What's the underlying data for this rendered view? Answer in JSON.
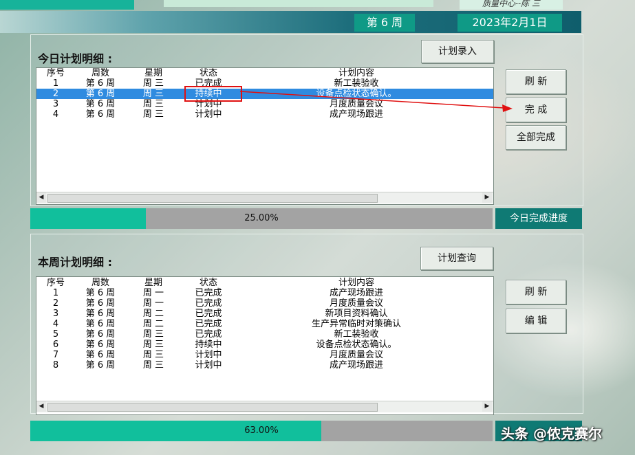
{
  "header": {
    "top_right_tab": "质量中心--陈 三",
    "week_label": "第 6 周",
    "date_label": "2023年2月1日"
  },
  "today": {
    "title": "今日计划明细 :",
    "entry_button": "计划录入",
    "columns": [
      "序号",
      "周数",
      "星期",
      "状态",
      "计划内容"
    ],
    "rows": [
      {
        "no": "1",
        "week": "第 6 周",
        "day": "周 三",
        "status": "已完成",
        "content": "新工装验收"
      },
      {
        "no": "2",
        "week": "第 6 周",
        "day": "周 三",
        "status": "持续中",
        "content": "设备点检状态确认。"
      },
      {
        "no": "3",
        "week": "第 6 周",
        "day": "周 三",
        "status": "计划中",
        "content": "月度质量会议"
      },
      {
        "no": "4",
        "week": "第 6 周",
        "day": "周 三",
        "status": "计划中",
        "content": "成产现场跟进"
      }
    ],
    "selected_row": 1,
    "buttons": {
      "refresh": "刷 新",
      "complete": "完 成",
      "complete_all": "全部完成"
    },
    "progress_text": "25.00%",
    "progress_value": 0.25,
    "progress_tag": "今日完成进度"
  },
  "week": {
    "title": "本周计划明细 :",
    "query_button": "计划查询",
    "columns": [
      "序号",
      "周数",
      "星期",
      "状态",
      "计划内容"
    ],
    "rows": [
      {
        "no": "1",
        "week": "第 6 周",
        "day": "周 一",
        "status": "已完成",
        "content": "成产现场跟进"
      },
      {
        "no": "2",
        "week": "第 6 周",
        "day": "周 一",
        "status": "已完成",
        "content": "月度质量会议"
      },
      {
        "no": "3",
        "week": "第 6 周",
        "day": "周 二",
        "status": "已完成",
        "content": "新项目资料确认"
      },
      {
        "no": "4",
        "week": "第 6 周",
        "day": "周 二",
        "status": "已完成",
        "content": "生产异常临时对策确认"
      },
      {
        "no": "5",
        "week": "第 6 周",
        "day": "周 三",
        "status": "已完成",
        "content": "新工装验收"
      },
      {
        "no": "6",
        "week": "第 6 周",
        "day": "周 三",
        "status": "持续中",
        "content": "设备点检状态确认。"
      },
      {
        "no": "7",
        "week": "第 6 周",
        "day": "周 三",
        "status": "计划中",
        "content": "月度质量会议"
      },
      {
        "no": "8",
        "week": "第 6 周",
        "day": "周 三",
        "status": "计划中",
        "content": "成产现场跟进"
      }
    ],
    "buttons": {
      "refresh": "刷 新",
      "edit": "编 辑"
    },
    "progress_text": "63.00%",
    "progress_value": 0.63
  },
  "watermark": "头条 @侬克赛尔",
  "colors": {
    "accent_teal": "#0f9a86",
    "progress_fill": "#11bf9c",
    "selection": "#2f8be0",
    "annotation_red": "#e01010"
  }
}
